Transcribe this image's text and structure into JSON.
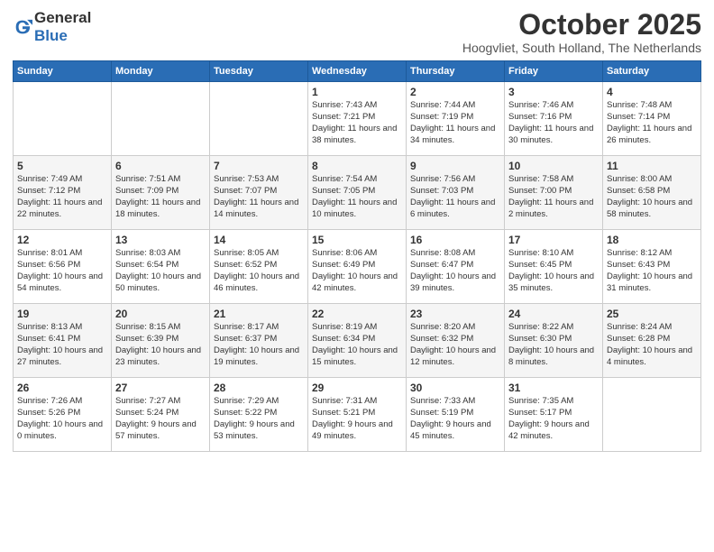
{
  "header": {
    "logo_general": "General",
    "logo_blue": "Blue",
    "month": "October 2025",
    "location": "Hoogvliet, South Holland, The Netherlands"
  },
  "days_of_week": [
    "Sunday",
    "Monday",
    "Tuesday",
    "Wednesday",
    "Thursday",
    "Friday",
    "Saturday"
  ],
  "weeks": [
    [
      {
        "day": "",
        "info": ""
      },
      {
        "day": "",
        "info": ""
      },
      {
        "day": "",
        "info": ""
      },
      {
        "day": "1",
        "info": "Sunrise: 7:43 AM\nSunset: 7:21 PM\nDaylight: 11 hours\nand 38 minutes."
      },
      {
        "day": "2",
        "info": "Sunrise: 7:44 AM\nSunset: 7:19 PM\nDaylight: 11 hours\nand 34 minutes."
      },
      {
        "day": "3",
        "info": "Sunrise: 7:46 AM\nSunset: 7:16 PM\nDaylight: 11 hours\nand 30 minutes."
      },
      {
        "day": "4",
        "info": "Sunrise: 7:48 AM\nSunset: 7:14 PM\nDaylight: 11 hours\nand 26 minutes."
      }
    ],
    [
      {
        "day": "5",
        "info": "Sunrise: 7:49 AM\nSunset: 7:12 PM\nDaylight: 11 hours\nand 22 minutes."
      },
      {
        "day": "6",
        "info": "Sunrise: 7:51 AM\nSunset: 7:09 PM\nDaylight: 11 hours\nand 18 minutes."
      },
      {
        "day": "7",
        "info": "Sunrise: 7:53 AM\nSunset: 7:07 PM\nDaylight: 11 hours\nand 14 minutes."
      },
      {
        "day": "8",
        "info": "Sunrise: 7:54 AM\nSunset: 7:05 PM\nDaylight: 11 hours\nand 10 minutes."
      },
      {
        "day": "9",
        "info": "Sunrise: 7:56 AM\nSunset: 7:03 PM\nDaylight: 11 hours\nand 6 minutes."
      },
      {
        "day": "10",
        "info": "Sunrise: 7:58 AM\nSunset: 7:00 PM\nDaylight: 11 hours\nand 2 minutes."
      },
      {
        "day": "11",
        "info": "Sunrise: 8:00 AM\nSunset: 6:58 PM\nDaylight: 10 hours\nand 58 minutes."
      }
    ],
    [
      {
        "day": "12",
        "info": "Sunrise: 8:01 AM\nSunset: 6:56 PM\nDaylight: 10 hours\nand 54 minutes."
      },
      {
        "day": "13",
        "info": "Sunrise: 8:03 AM\nSunset: 6:54 PM\nDaylight: 10 hours\nand 50 minutes."
      },
      {
        "day": "14",
        "info": "Sunrise: 8:05 AM\nSunset: 6:52 PM\nDaylight: 10 hours\nand 46 minutes."
      },
      {
        "day": "15",
        "info": "Sunrise: 8:06 AM\nSunset: 6:49 PM\nDaylight: 10 hours\nand 42 minutes."
      },
      {
        "day": "16",
        "info": "Sunrise: 8:08 AM\nSunset: 6:47 PM\nDaylight: 10 hours\nand 39 minutes."
      },
      {
        "day": "17",
        "info": "Sunrise: 8:10 AM\nSunset: 6:45 PM\nDaylight: 10 hours\nand 35 minutes."
      },
      {
        "day": "18",
        "info": "Sunrise: 8:12 AM\nSunset: 6:43 PM\nDaylight: 10 hours\nand 31 minutes."
      }
    ],
    [
      {
        "day": "19",
        "info": "Sunrise: 8:13 AM\nSunset: 6:41 PM\nDaylight: 10 hours\nand 27 minutes."
      },
      {
        "day": "20",
        "info": "Sunrise: 8:15 AM\nSunset: 6:39 PM\nDaylight: 10 hours\nand 23 minutes."
      },
      {
        "day": "21",
        "info": "Sunrise: 8:17 AM\nSunset: 6:37 PM\nDaylight: 10 hours\nand 19 minutes."
      },
      {
        "day": "22",
        "info": "Sunrise: 8:19 AM\nSunset: 6:34 PM\nDaylight: 10 hours\nand 15 minutes."
      },
      {
        "day": "23",
        "info": "Sunrise: 8:20 AM\nSunset: 6:32 PM\nDaylight: 10 hours\nand 12 minutes."
      },
      {
        "day": "24",
        "info": "Sunrise: 8:22 AM\nSunset: 6:30 PM\nDaylight: 10 hours\nand 8 minutes."
      },
      {
        "day": "25",
        "info": "Sunrise: 8:24 AM\nSunset: 6:28 PM\nDaylight: 10 hours\nand 4 minutes."
      }
    ],
    [
      {
        "day": "26",
        "info": "Sunrise: 7:26 AM\nSunset: 5:26 PM\nDaylight: 10 hours\nand 0 minutes."
      },
      {
        "day": "27",
        "info": "Sunrise: 7:27 AM\nSunset: 5:24 PM\nDaylight: 9 hours\nand 57 minutes."
      },
      {
        "day": "28",
        "info": "Sunrise: 7:29 AM\nSunset: 5:22 PM\nDaylight: 9 hours\nand 53 minutes."
      },
      {
        "day": "29",
        "info": "Sunrise: 7:31 AM\nSunset: 5:21 PM\nDaylight: 9 hours\nand 49 minutes."
      },
      {
        "day": "30",
        "info": "Sunrise: 7:33 AM\nSunset: 5:19 PM\nDaylight: 9 hours\nand 45 minutes."
      },
      {
        "day": "31",
        "info": "Sunrise: 7:35 AM\nSunset: 5:17 PM\nDaylight: 9 hours\nand 42 minutes."
      },
      {
        "day": "",
        "info": ""
      }
    ]
  ]
}
